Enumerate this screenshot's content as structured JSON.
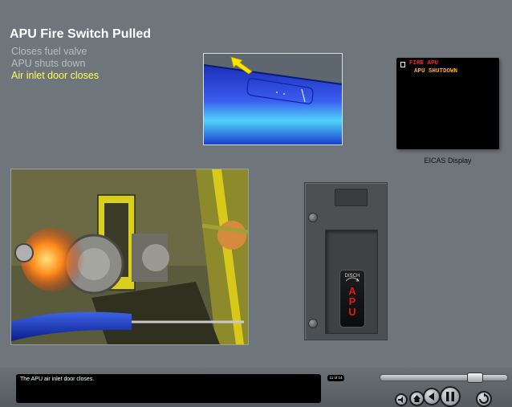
{
  "lesson": {
    "title": "APU Fire Switch Pulled",
    "steps": [
      {
        "text": "Closes fuel valve",
        "state": "done"
      },
      {
        "text": "APU shuts down",
        "state": "done"
      },
      {
        "text": "Air inlet door closes",
        "state": "active"
      }
    ],
    "step_colors": {
      "done": "#b8bdc1",
      "active": "#ffff55"
    }
  },
  "eicas": {
    "caption": "EICAS Display",
    "messages": [
      {
        "text": "FIRE APU",
        "color": "#ff2222"
      },
      {
        "text": "APU SHUTDOWN",
        "color": "#ffb000"
      }
    ]
  },
  "fire_panel": {
    "placard_text": "",
    "handle_top_label": "DISCH",
    "handle_letters": [
      "A",
      "P",
      "U"
    ],
    "handle_letter_color": "#e01818"
  },
  "footer": {
    "caption_text": "The APU air inlet door closes.",
    "page_count": "11 of 14",
    "scrubber_progress": 0.77,
    "controls": [
      "volume-icon",
      "home-icon",
      "back-icon",
      "pause-icon",
      "replay-icon"
    ]
  }
}
